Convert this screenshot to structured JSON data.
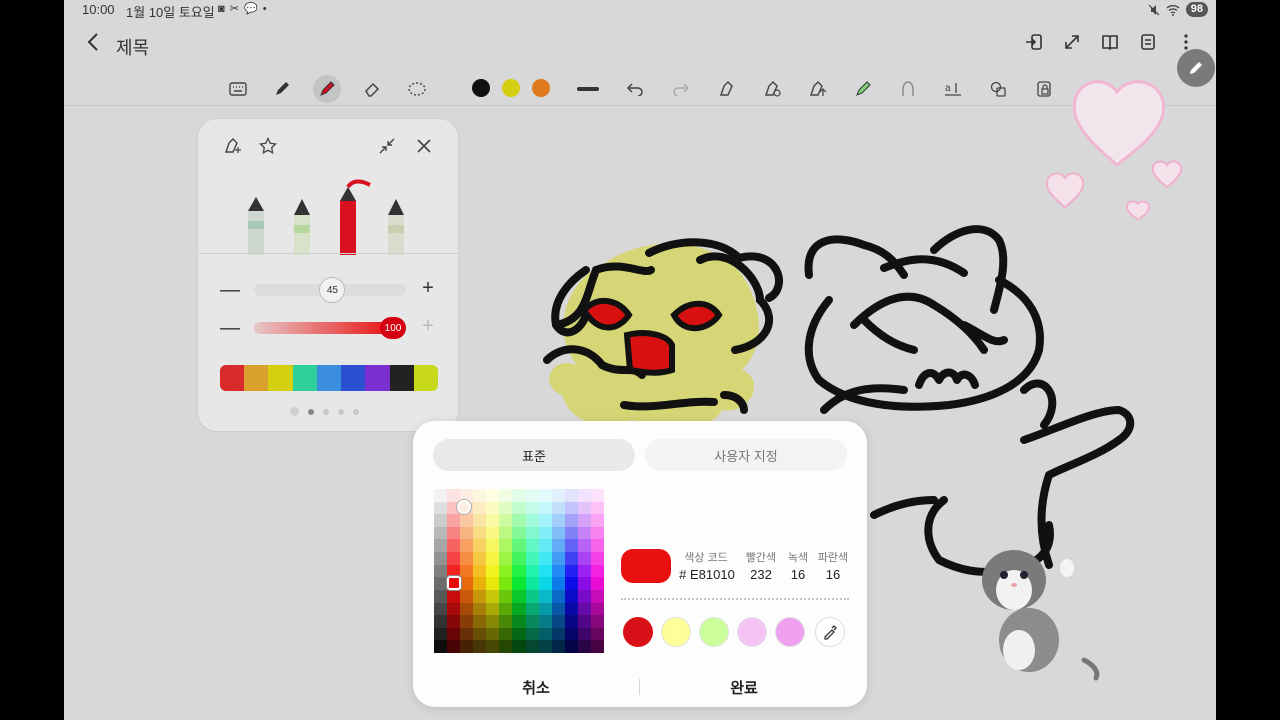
{
  "status": {
    "time": "10:00",
    "date": "1월 10일 토요일",
    "icons": "◙ ✂ 💬 •",
    "battery": "98"
  },
  "header": {
    "title": "제목"
  },
  "toolbar": {
    "colors": [
      "#111111",
      "#d4cf10",
      "#e07820"
    ]
  },
  "pen_panel": {
    "size_value": "45",
    "opacity_value": "100",
    "size_fraction": 0.45,
    "opacity_fraction": 1.0,
    "palette": [
      "#d92b2b",
      "#d9a02b",
      "#d4cf10",
      "#2fcf9a",
      "#3b8de0",
      "#2a4fd0",
      "#7a2fd0",
      "#222222",
      "#c8d81a"
    ]
  },
  "color_dialog": {
    "tab_standard": "표준",
    "tab_custom": "사용자 지정",
    "label_code": "색상 코드",
    "label_red": "빨간색",
    "label_green": "녹색",
    "label_blue": "파란색",
    "value_code": "# E81010",
    "value_red": "232",
    "value_green": "16",
    "value_blue": "16",
    "current_color": "#e81010",
    "recent_colors": [
      "#d81018",
      "#ffff99",
      "#ccff99",
      "#f4c4f4",
      "#f0a0f0"
    ],
    "cancel_label": "취소",
    "done_label": "완료"
  }
}
